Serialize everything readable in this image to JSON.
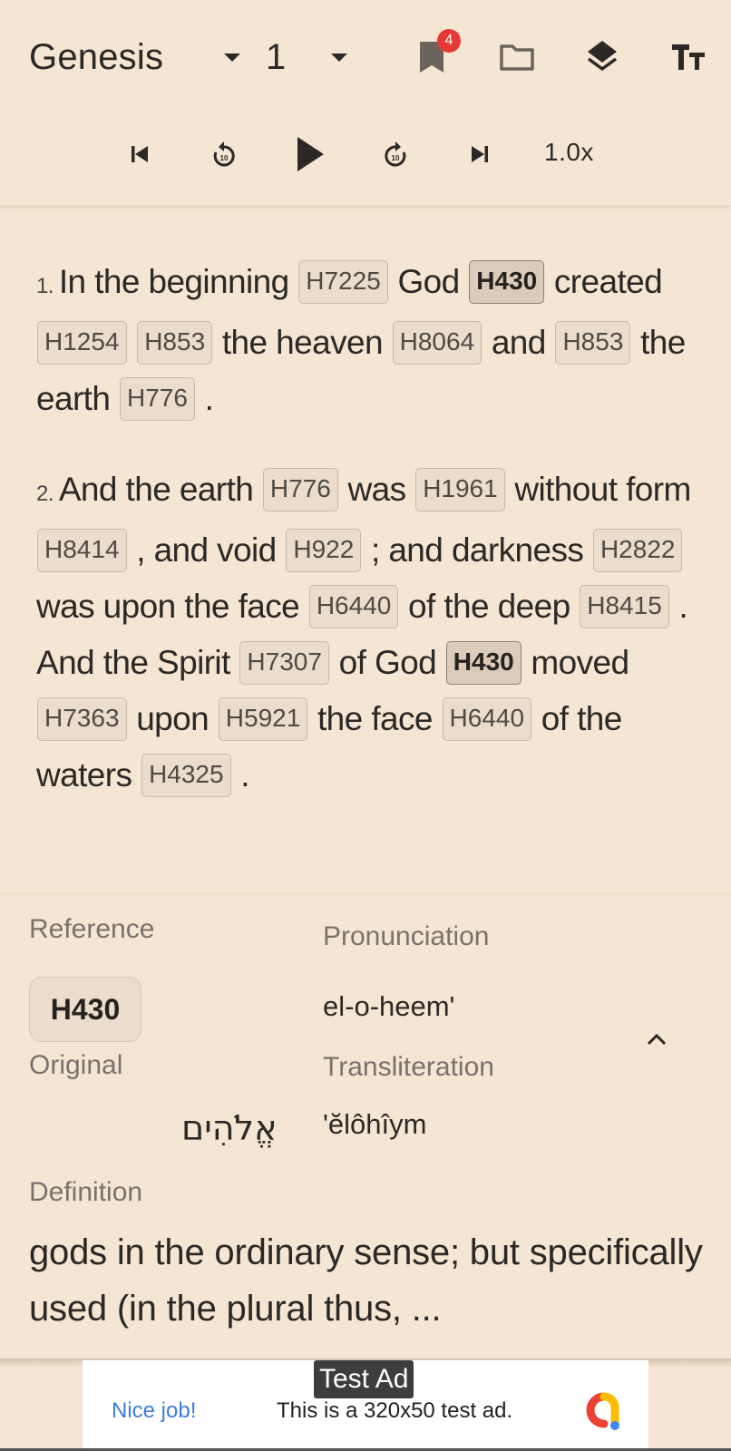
{
  "header": {
    "book": "Genesis",
    "chapter": "1",
    "bookmark_count": "4",
    "icons": {
      "book_dropdown": "caret-down-icon",
      "chapter_dropdown": "caret-down-icon",
      "bookmarks": "bookmark-icon",
      "folder": "folder-icon",
      "layers": "layers-icon",
      "text_size": "text-size-icon"
    }
  },
  "player": {
    "icons": [
      "skip-previous-icon",
      "replay-10-icon",
      "play-icon",
      "forward-10-icon",
      "skip-next-icon"
    ],
    "replay_seconds": "10",
    "forward_seconds": "10",
    "speed": "1.0x"
  },
  "verses": [
    {
      "number": "1.",
      "segments": [
        {
          "t": "In the beginning ",
          "s": "H7225"
        },
        {
          "t": "God ",
          "s": "H430",
          "active": true
        },
        {
          "t": "created ",
          "s": "H1254"
        },
        {
          "t": "",
          "s": "H853"
        },
        {
          "t": "the heaven ",
          "s": "H8064"
        },
        {
          "t": "and ",
          "s": "H853"
        },
        {
          "t": "the earth ",
          "s": "H776"
        },
        {
          "t": "."
        }
      ]
    },
    {
      "number": "2.",
      "segments": [
        {
          "t": "And the earth ",
          "s": "H776"
        },
        {
          "t": "was ",
          "s": "H1961"
        },
        {
          "t": "without form ",
          "s": "H8414"
        },
        {
          "t": ", and void ",
          "s": "H922"
        },
        {
          "t": "; and darkness ",
          "s": "H2822"
        },
        {
          "t": "was upon the face ",
          "s": "H6440"
        },
        {
          "t": "of the deep ",
          "s": "H8415"
        },
        {
          "t": ". And the Spirit ",
          "s": "H7307"
        },
        {
          "t": "of God ",
          "s": "H430",
          "active": true
        },
        {
          "t": "moved ",
          "s": "H7363"
        },
        {
          "t": "upon ",
          "s": "H5921"
        },
        {
          "t": "the face ",
          "s": "H6440"
        },
        {
          "t": "of the waters ",
          "s": "H4325"
        },
        {
          "t": "."
        }
      ]
    }
  ],
  "details": {
    "reference_label": "Reference",
    "reference": "H430",
    "pronunciation_label": "Pronunciation",
    "pronunciation": "el-o-heem'",
    "original_label": "Original",
    "original": "אֱלֹהִים",
    "transliteration_label": "Transliteration",
    "transliteration": "'ĕlôhîym",
    "definition_label": "Definition",
    "definition": "gods in the ordinary sense; but specifically used (in the plural thus, ...",
    "collapse_icon": "chevron-up-icon"
  },
  "ad": {
    "badge": "Test Ad",
    "headline": "Nice job!",
    "text": "This is a 320x50 test ad.",
    "logo": "ad-logo-icon",
    "colors": {
      "red": "#ea4335",
      "yellow": "#fbbc04",
      "blue": "#4285f4"
    }
  },
  "colors": {
    "background": "#f5e6d3",
    "chip": "#ebdccb",
    "chip_active": "#dbcbb8",
    "badge": "#e53935",
    "link": "#3b7ddd"
  }
}
